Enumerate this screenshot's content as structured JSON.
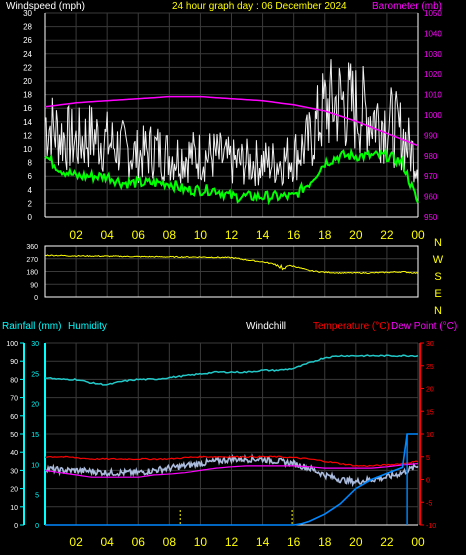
{
  "colors": {
    "background": "#000000",
    "grid": "#3a3a3a",
    "axis": "#ffffff",
    "wind": "#f0f0f0",
    "wind_avg": "#00ff00",
    "barometer": "#ff00ff",
    "direction": "#ffff00",
    "hour_labels": "#ffff00",
    "compass": "#ffff00",
    "rainfall": "#00ffff",
    "humidity": "#00ffff",
    "humidity_line": "#22c8c8",
    "windchill": "#ffffff",
    "temperature": "#ff0000",
    "dewpoint": "#ff00ff",
    "rain_line": "#0088ff",
    "rain_marker": "#ffff00",
    "temp_band": "#aabbdd"
  },
  "top": {
    "left_title": "Windspeed (mph)",
    "center_title": "24 hour graph day : 06 December 2024",
    "right_title": "Barometer (mb)"
  },
  "compass": {
    "labels": [
      "N",
      "W",
      "S",
      "E",
      "N"
    ]
  },
  "bottom": {
    "rainfall_title": "Rainfall (mm)",
    "humidity_title": "Humidity",
    "windchill_title": "Windchill",
    "temperature_title": "Temperature (°C)",
    "dewpoint_title": "Dew Point (°C)"
  },
  "chart_data": [
    {
      "type": "line",
      "title": "24 hour graph day : 06 December 2024",
      "x_ticks": [
        "02",
        "04",
        "06",
        "08",
        "10",
        "12",
        "14",
        "16",
        "18",
        "20",
        "22",
        "00"
      ],
      "xlim": [
        0,
        24
      ],
      "y_left": {
        "label": "Windspeed (mph)",
        "ticks": [
          0,
          2,
          4,
          6,
          8,
          10,
          12,
          14,
          16,
          18,
          20,
          22,
          24,
          26,
          28,
          30
        ],
        "lim": [
          0,
          30
        ]
      },
      "y_right": {
        "label": "Barometer (mb)",
        "ticks": [
          950,
          960,
          970,
          980,
          990,
          1000,
          1010,
          1020,
          1030,
          1040,
          1050
        ],
        "lim": [
          950,
          1050
        ]
      },
      "series": [
        {
          "name": "Windspeed",
          "axis": "left",
          "x": [
            0,
            1,
            2,
            3,
            4,
            5,
            6,
            7,
            8,
            9,
            10,
            11,
            12,
            13,
            14,
            15,
            16,
            17,
            18,
            19,
            20,
            21,
            22,
            23,
            24
          ],
          "values": [
            14,
            12,
            11,
            12,
            11,
            10,
            9,
            10,
            9,
            9,
            9,
            9,
            8,
            8,
            8,
            8,
            9,
            11,
            16,
            17,
            16,
            15,
            14,
            12,
            8
          ]
        },
        {
          "name": "Average windspeed",
          "axis": "left",
          "x": [
            0,
            1,
            2,
            3,
            4,
            5,
            6,
            7,
            8,
            9,
            10,
            11,
            12,
            13,
            14,
            15,
            16,
            17,
            18,
            19,
            20,
            21,
            22,
            23,
            24
          ],
          "values": [
            9,
            7,
            6,
            6,
            6,
            5,
            5,
            5,
            5,
            4,
            4,
            4,
            3,
            3,
            3,
            3,
            3,
            5,
            8,
            9,
            9,
            9,
            9,
            8,
            2
          ]
        },
        {
          "name": "Barometer",
          "axis": "right",
          "x": [
            0,
            2,
            4,
            6,
            8,
            10,
            12,
            14,
            16,
            18,
            20,
            22,
            24
          ],
          "values": [
            1004,
            1006,
            1007,
            1008,
            1009,
            1009,
            1008,
            1007,
            1005,
            1002,
            997,
            991,
            985
          ]
        }
      ]
    },
    {
      "type": "line",
      "title": "Wind direction",
      "x_ticks": [
        "02",
        "04",
        "06",
        "08",
        "10",
        "12",
        "14",
        "16",
        "18",
        "20",
        "22",
        "00"
      ],
      "xlim": [
        0,
        24
      ],
      "y_left": {
        "ticks": [
          0,
          90,
          180,
          270,
          360
        ],
        "lim": [
          0,
          360
        ]
      },
      "series": [
        {
          "name": "Wind direction",
          "x": [
            0,
            2,
            4,
            6,
            8,
            10,
            12,
            13,
            14,
            15,
            16,
            17,
            18,
            19,
            20,
            21,
            22,
            23,
            24
          ],
          "values": [
            295,
            290,
            288,
            285,
            283,
            282,
            278,
            262,
            248,
            228,
            218,
            186,
            175,
            170,
            170,
            170,
            174,
            178,
            168
          ]
        }
      ]
    },
    {
      "type": "line",
      "x_ticks": [
        "02",
        "04",
        "06",
        "08",
        "10",
        "12",
        "14",
        "16",
        "18",
        "20",
        "22",
        "00"
      ],
      "xlim": [
        0,
        24
      ],
      "y_rain": {
        "label": "Rainfall (mm)",
        "ticks": [
          0,
          5,
          10,
          15,
          20,
          25,
          30
        ],
        "lim": [
          0,
          30
        ]
      },
      "y_humidity": {
        "label": "Humidity",
        "ticks": [
          0,
          10,
          20,
          30,
          40,
          50,
          60,
          70,
          80,
          90,
          100
        ],
        "lim": [
          0,
          100
        ]
      },
      "y_temp": {
        "label": "Temperature (°C)",
        "ticks": [
          -10,
          -5,
          0,
          5,
          10,
          15,
          20,
          25,
          30
        ],
        "lim": [
          -10,
          30
        ]
      },
      "series": [
        {
          "name": "Humidity",
          "axis": "humidity",
          "x": [
            0,
            1,
            2,
            3,
            4,
            5,
            6,
            7,
            8,
            9,
            10,
            11,
            12,
            13,
            14,
            15,
            16,
            17,
            18,
            19,
            20,
            21,
            22,
            23,
            24
          ],
          "values": [
            81,
            80,
            80,
            78,
            77,
            79,
            80,
            80,
            81,
            82,
            83,
            84,
            84,
            84,
            85,
            85,
            86,
            89,
            92,
            93,
            93,
            93,
            93,
            93,
            93
          ]
        },
        {
          "name": "Windchill",
          "axis": "temp",
          "x": [
            0,
            1,
            2,
            3,
            4,
            5,
            6,
            7,
            8,
            9,
            10,
            11,
            12,
            13,
            14,
            15,
            16,
            17,
            18,
            19,
            20,
            21,
            22,
            23,
            24
          ],
          "values": [
            2.5,
            2.0,
            2.0,
            1.8,
            1.5,
            1.5,
            1.5,
            2.0,
            2.5,
            3.0,
            3.5,
            4.0,
            4.5,
            4.5,
            4.5,
            4.0,
            3.5,
            2.5,
            1.0,
            0,
            -0.5,
            0,
            0.5,
            1.5,
            3.0
          ]
        },
        {
          "name": "Temperature",
          "axis": "temp",
          "x": [
            0,
            1,
            2,
            3,
            4,
            5,
            6,
            7,
            8,
            9,
            10,
            11,
            12,
            13,
            14,
            15,
            16,
            17,
            18,
            19,
            20,
            21,
            22,
            23,
            24
          ],
          "values": [
            5.0,
            5.0,
            4.8,
            4.5,
            4.5,
            4.5,
            4.5,
            4.5,
            4.5,
            4.8,
            5.0,
            5.0,
            5.0,
            5.0,
            5.0,
            5.0,
            4.8,
            4.5,
            4.0,
            3.5,
            3.0,
            3.0,
            3.2,
            3.5,
            4.0
          ]
        },
        {
          "name": "Dew Point",
          "axis": "temp",
          "x": [
            0,
            1,
            2,
            3,
            4,
            5,
            6,
            7,
            8,
            9,
            10,
            11,
            12,
            13,
            14,
            15,
            16,
            17,
            18,
            19,
            20,
            21,
            22,
            23,
            24
          ],
          "values": [
            2.0,
            1.5,
            1.0,
            0.5,
            0.5,
            0.5,
            0.5,
            1.0,
            1.2,
            1.5,
            2.0,
            2.5,
            2.8,
            3.0,
            3.0,
            3.0,
            3.0,
            2.8,
            2.5,
            2.5,
            2.5,
            2.5,
            2.8,
            3.2,
            3.5
          ]
        },
        {
          "name": "Rainfall",
          "axis": "rain",
          "x": [
            0,
            16,
            16.5,
            17,
            18,
            19,
            20,
            21,
            22,
            23,
            23.3,
            24
          ],
          "values": [
            0,
            0,
            0.2,
            0.6,
            1.8,
            3.5,
            6.0,
            7.5,
            8.5,
            9.5,
            15.0,
            15.0
          ]
        }
      ]
    }
  ]
}
